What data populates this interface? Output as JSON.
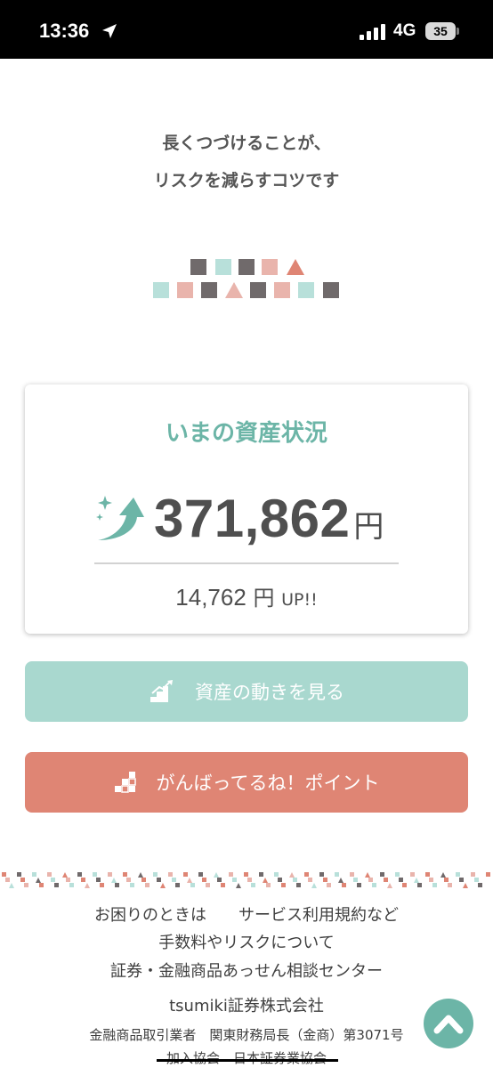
{
  "status_bar": {
    "time": "13:36",
    "network": "4G",
    "battery": "35"
  },
  "tagline": {
    "line1": "長くつづけることが、",
    "line2": "リスクを減らすコツです"
  },
  "asset_card": {
    "title": "いまの資産状況",
    "amount": "371,862",
    "unit": "円",
    "gain": "14,762",
    "gain_unit": "円",
    "gain_suffix": "UP!!"
  },
  "buttons": {
    "assets_label": "資産の動きを見る",
    "points_label": "がんばってるね！ポイント"
  },
  "footer": {
    "help": "お困りのときは",
    "terms": "サービス利用規約など",
    "fees": "手数料やリスクについて",
    "adr": "証券・金融商品あっせん相談センター",
    "company": "tsumiki証券株式会社",
    "registration": "金融商品取引業者　関東財務局長（金商）第3071号",
    "association": "加入協会　日本証券業協会"
  },
  "colors": {
    "teal": "#6cb5a7",
    "mint": "#a9d8cf",
    "salmon": "#df8574",
    "gray_block": "#706a6b",
    "light_teal_block": "#b8e0da",
    "pink_block": "#e9b4ac"
  },
  "icons": {
    "location": "location-arrow-icon",
    "signal": "cellular-signal-icon",
    "growth": "growth-arrow-icon",
    "stairs": "stairs-chart-icon",
    "blocks": "blocks-icon",
    "scroll_top": "chevron-up-icon"
  }
}
